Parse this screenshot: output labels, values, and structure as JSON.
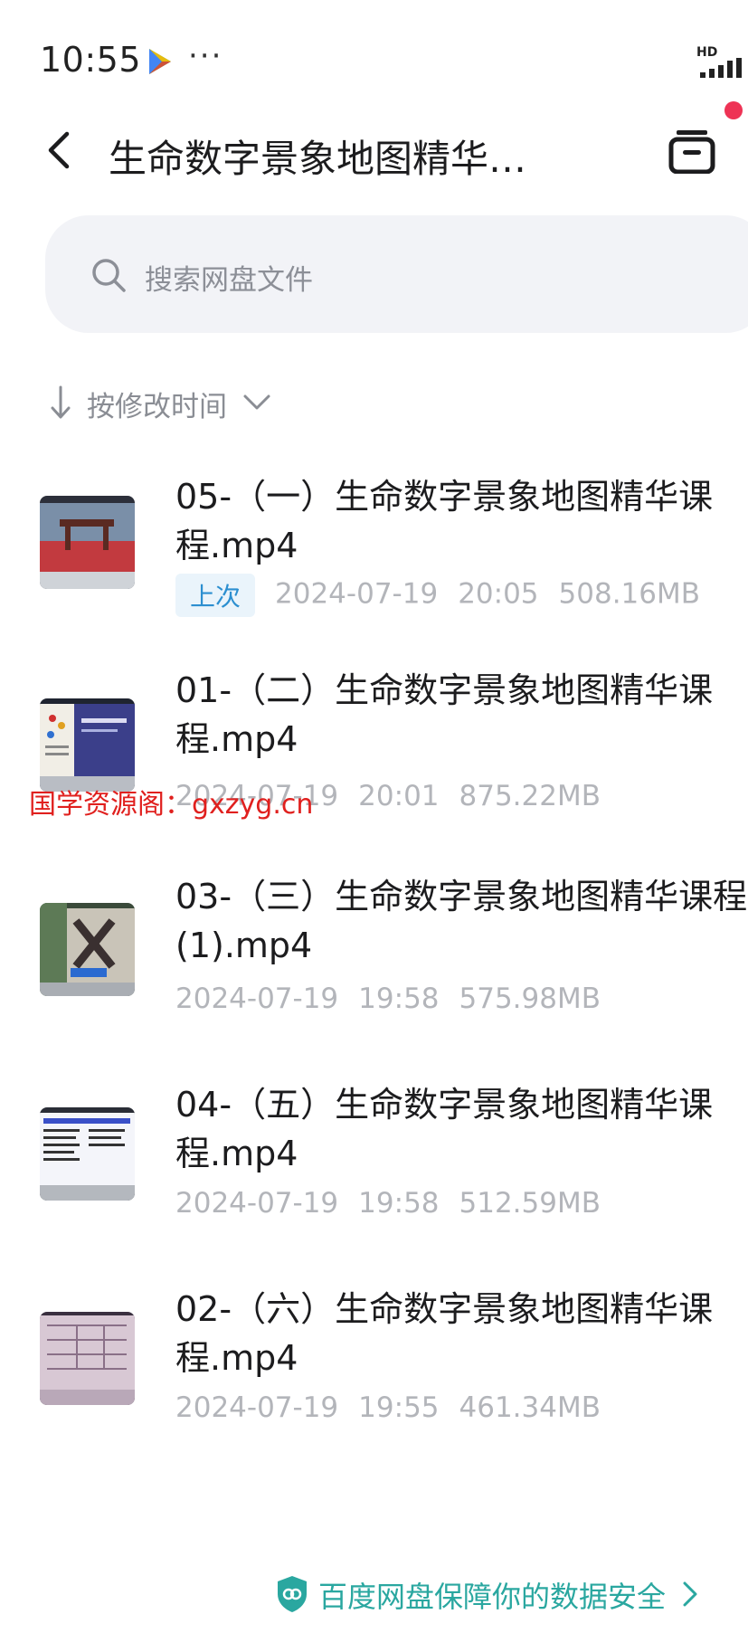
{
  "status_bar": {
    "time": "10:55",
    "more": "···",
    "network": "HD",
    "icons": [
      "play-store-icon",
      "signal-icon"
    ]
  },
  "header": {
    "title": "生命数字景象地图精华…",
    "back_icon": "back-icon",
    "right_icon": "archive-icon",
    "notification_dot_color": "#ee3355"
  },
  "search": {
    "placeholder": "搜索网盘文件"
  },
  "sort": {
    "label": "按修改时间"
  },
  "files": [
    {
      "name": "05-（一）生命数字景象地图精华课程.mp4",
      "badge": "上次",
      "date": "2024-07-19",
      "time": "20:05",
      "size": "508.16MB"
    },
    {
      "name": "01-（二）生命数字景象地图精华课程.mp4",
      "badge": "",
      "date": "2024-07-19",
      "time": "20:01",
      "size": "875.22MB"
    },
    {
      "name": "03-（三）生命数字景象地图精华课程(1).mp4",
      "badge": "",
      "date": "2024-07-19",
      "time": "19:58",
      "size": "575.98MB"
    },
    {
      "name": "04-（五）生命数字景象地图精华课程.mp4",
      "badge": "",
      "date": "2024-07-19",
      "time": "19:58",
      "size": "512.59MB"
    },
    {
      "name": "02-（六）生命数字景象地图精华课程.mp4",
      "badge": "",
      "date": "2024-07-19",
      "time": "19:55",
      "size": "461.34MB"
    }
  ],
  "watermark": "国学资源阁：gxzyg.cn",
  "footer": {
    "text": "百度网盘保障你的数据安全",
    "accent": "#2aa7a0"
  }
}
